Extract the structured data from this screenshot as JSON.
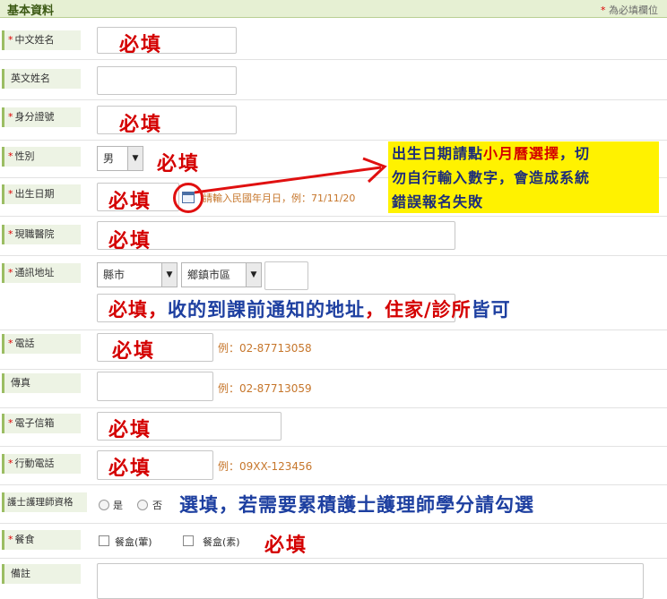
{
  "header": {
    "title": "基本資料",
    "required_note": "為必填欄位",
    "star": "*"
  },
  "fields": {
    "chinese_name": {
      "label": "中文姓名",
      "note": "必填"
    },
    "english_name": {
      "label": "英文姓名"
    },
    "id_number": {
      "label": "身分證號",
      "note": "必填"
    },
    "gender": {
      "label": "性別",
      "value": "男",
      "note": "必填"
    },
    "birthdate": {
      "label": "出生日期",
      "note": "必填",
      "hint": "請輸入民國年月日，例：71/11/20",
      "icon": "calendar-icon"
    },
    "hospital": {
      "label": "現職醫院",
      "note": "必填"
    },
    "address": {
      "label": "通訊地址",
      "city": "縣市",
      "district": "鄉鎮市區",
      "note_red1": "必填，",
      "note_blue1": "收的到課前通知的地址",
      "note_red2": "，住家/診所",
      "note_blue2": "皆可"
    },
    "phone": {
      "label": "電話",
      "note": "必填",
      "hint": "例：02-87713058"
    },
    "fax": {
      "label": "傳真",
      "hint": "例：02-87713059"
    },
    "email": {
      "label": "電子信箱",
      "note": "必填"
    },
    "mobile": {
      "label": "行動電話",
      "note": "必填",
      "hint": "例：09XX-123456"
    },
    "nurse_license": {
      "label": "護士護理師資格",
      "yes": "是",
      "no": "否",
      "note": "選填，若需要累積護士護理師學分請勾選"
    },
    "meal": {
      "label": "餐食",
      "option1": "餐盒(葷)",
      "option2": "餐盒(素)",
      "note": "必填"
    },
    "remarks": {
      "label": "備註"
    }
  },
  "annotation": {
    "line1a": "出生日期請點",
    "line1b": "小月曆選擇",
    "line1c": "，切",
    "line2a": "勿自行輸入數字",
    "line2b": "，會造成系統",
    "line3": "錯誤報名失敗"
  },
  "colors": {
    "required": "#d40000",
    "note_blue": "#1d3fa0",
    "highlight": "#fff200",
    "label_bg": "#edf3e4"
  }
}
